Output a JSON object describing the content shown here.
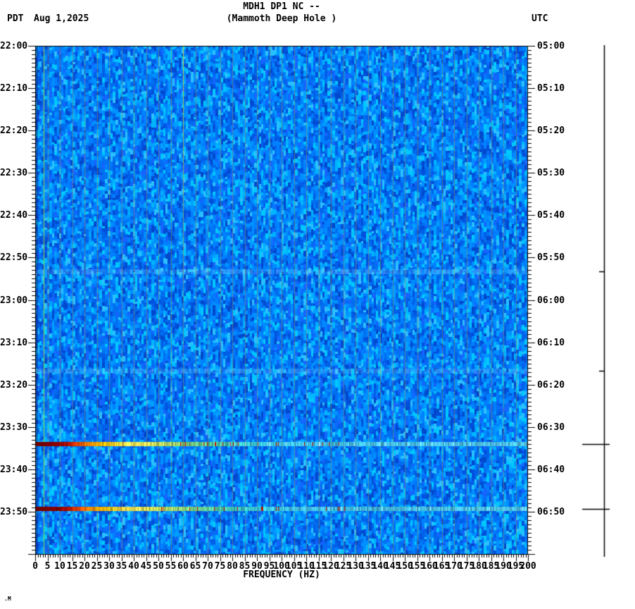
{
  "header": {
    "tz_left": "PDT",
    "date": "Aug 1,2025",
    "tz_right": "UTC"
  },
  "title": {
    "line1": "MDH1 DP1 NC --",
    "line2": "(Mammoth Deep Hole )"
  },
  "axes": {
    "left_time_labels": [
      "22:00",
      "22:10",
      "22:20",
      "22:30",
      "22:40",
      "22:50",
      "23:00",
      "23:10",
      "23:20",
      "23:30",
      "23:40",
      "23:50"
    ],
    "right_time_labels": [
      "05:00",
      "05:10",
      "05:20",
      "05:30",
      "05:40",
      "05:50",
      "06:00",
      "06:10",
      "06:20",
      "06:30",
      "06:40",
      "06:50"
    ],
    "freq_tick_labels": [
      "0",
      "5",
      "10",
      "15",
      "20",
      "25",
      "30",
      "35",
      "40",
      "45",
      "50",
      "55",
      "60",
      "65",
      "70",
      "75",
      "80",
      "85",
      "90",
      "95",
      "100",
      "105",
      "110",
      "115",
      "120",
      "125",
      "130",
      "135",
      "140",
      "145",
      "150",
      "155",
      "160",
      "165",
      "170",
      "175",
      "180",
      "185",
      "190",
      "195",
      "200"
    ],
    "xlabel": "FREQUENCY (HZ)"
  },
  "footer_note": ".M",
  "chart_data": {
    "type": "heatmap",
    "title": "MDH1 DP1 NC -- (Mammoth Deep Hole )",
    "xlabel": "FREQUENCY (HZ)",
    "x_range_hz": [
      0,
      200
    ],
    "x_major_tick_hz": 5,
    "x_minor_tick_hz": 1,
    "time_axis_left_tz": "PDT",
    "time_axis_right_tz": "UTC",
    "time_start_pdt": "22:00",
    "time_end_pdt": "24:00",
    "time_start_utc": "05:00",
    "time_end_utc": "07:00",
    "time_major_tick_min": 10,
    "time_minor_tick_min": 1,
    "background_description": "random blue spectral noise mosaic",
    "noise_palette": [
      "#0070f0",
      "#0070f0",
      "#0080ff",
      "#0080ff",
      "#0090ff",
      "#0090ff",
      "#00a0ff",
      "#0060e8",
      "#0060e8",
      "#0050dd",
      "#00b4ff",
      "#2bc0ff",
      "#0048cc",
      "#1565ff",
      "#00c8ff"
    ],
    "gridline_every_hz": 5,
    "gridline_color": "rgba(150,140,100,0.55)",
    "persistent_lines": [
      {
        "freq_hz": 3.4,
        "color": "#9fe32e",
        "extent": "full height"
      },
      {
        "freq_hz": 60,
        "color": "#c2d23c",
        "extent": "fades out around 23:02 PDT"
      }
    ],
    "event_color_stops": [
      [
        0,
        "#6e0000"
      ],
      [
        9,
        "#8f0000"
      ],
      [
        13,
        "#cc0f00"
      ],
      [
        17,
        "#f04500"
      ],
      [
        22,
        "#ff8c00"
      ],
      [
        28,
        "#ffc400"
      ],
      [
        36,
        "#ffe34e"
      ],
      [
        46,
        "#e2ea58"
      ],
      [
        56,
        "#aade6e"
      ],
      [
        68,
        "#6cd896"
      ],
      [
        80,
        "#44d1c0"
      ],
      [
        92,
        "#3ccbe4"
      ],
      [
        110,
        "#46c6f0"
      ],
      [
        200,
        "#52c9f4"
      ]
    ],
    "events": [
      {
        "time_pdt": "22:53",
        "time_utc": "05:53",
        "minutes_from_start": 53.3,
        "strength": "weak",
        "freq_extent_hz": [
          0,
          200
        ],
        "description": "faint light-blue broadband band"
      },
      {
        "time_pdt": "23:17",
        "time_utc": "06:17",
        "minutes_from_start": 76.7,
        "strength": "weak",
        "freq_extent_hz": [
          0,
          200
        ],
        "description": "very faint light-blue broadband band"
      },
      {
        "time_pdt": "23:34",
        "time_utc": "06:34",
        "minutes_from_start": 94.0,
        "strength": "strong",
        "freq_extent_hz": [
          0,
          200
        ],
        "description": "broadband event: dark red at low freq grading to yellow then cyan at high freq"
      },
      {
        "time_pdt": "23:49",
        "time_utc": "06:49",
        "minutes_from_start": 109.3,
        "strength": "strong",
        "freq_extent_hz": [
          0,
          200
        ],
        "description": "broadband event: dark red at low freq grading to yellow then cyan at high freq"
      }
    ],
    "amplitude_bar_ticks": [
      {
        "minutes_from_start": 53.3,
        "size": "small"
      },
      {
        "minutes_from_start": 76.7,
        "size": "small"
      },
      {
        "minutes_from_start": 94.0,
        "size": "large"
      },
      {
        "minutes_from_start": 109.3,
        "size": "large"
      }
    ]
  }
}
